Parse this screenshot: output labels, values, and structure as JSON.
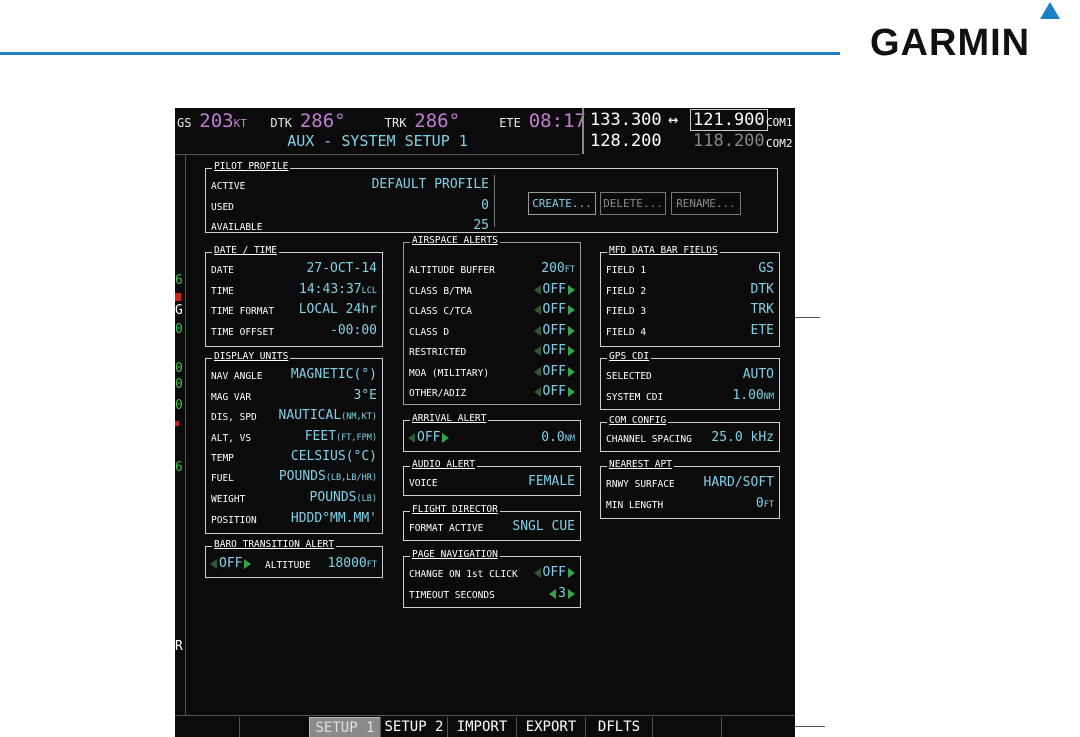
{
  "brand": "GARMIN",
  "topbar": {
    "gs_label": "GS",
    "gs_value": "203",
    "gs_unit": "KT",
    "dtk_label": "DTK",
    "dtk_value": "286°",
    "trk_label": "TRK",
    "trk_value": "286°",
    "ete_label": "ETE",
    "ete_value": "08:17",
    "page_title": "AUX - SYSTEM SETUP 1"
  },
  "com": {
    "com1_active": "133.300",
    "swap": "↔",
    "com1_standby": "121.900",
    "com1_label": "COM1",
    "com2_active": "128.200",
    "com2_standby": "118.200",
    "com2_label": "COM2"
  },
  "left_strip": [
    "6",
    "G",
    "0",
    "0",
    "0",
    "0",
    "6",
    "R"
  ],
  "pilot_profile": {
    "title": "PILOT PROFILE",
    "rows": [
      {
        "k": "ACTIVE",
        "v": "DEFAULT PROFILE"
      },
      {
        "k": "USED",
        "v": "0"
      },
      {
        "k": "AVAILABLE",
        "v": "25"
      }
    ],
    "buttons": [
      "CREATE...",
      "DELETE...",
      "RENAME..."
    ]
  },
  "date_time": {
    "title": "DATE / TIME",
    "rows": [
      {
        "k": "DATE",
        "v": "27-OCT-14"
      },
      {
        "k": "TIME",
        "v": "14:43:37",
        "u": "LCL"
      },
      {
        "k": "TIME FORMAT",
        "v": "LOCAL 24hr"
      },
      {
        "k": "TIME OFFSET",
        "v": "-00:00"
      }
    ]
  },
  "display_units": {
    "title": "DISPLAY UNITS",
    "rows": [
      {
        "k": "NAV ANGLE",
        "v": "MAGNETIC(°)"
      },
      {
        "k": "MAG VAR",
        "v": "3°E"
      },
      {
        "k": "DIS, SPD",
        "v": "NAUTICAL",
        "u": "(NM,KT)"
      },
      {
        "k": "ALT, VS",
        "v": "FEET",
        "u": "(FT,FPM)"
      },
      {
        "k": "TEMP",
        "v": "CELSIUS(°C)"
      },
      {
        "k": "FUEL",
        "v": "POUNDS",
        "u": "(LB,LB/HR)"
      },
      {
        "k": "WEIGHT",
        "v": "POUNDS",
        "u": "(LB)"
      },
      {
        "k": "POSITION",
        "v": "HDDD°MM.MM'"
      }
    ]
  },
  "baro_alert": {
    "title": "BARO TRANSITION ALERT",
    "state": "OFF",
    "alt_label": "ALTITUDE",
    "alt_value": "18000",
    "alt_unit": "FT"
  },
  "airspace_alerts": {
    "title": "AIRSPACE ALERTS",
    "buffer_label": "ALTITUDE BUFFER",
    "buffer_value": "200",
    "buffer_unit": "FT",
    "rows": [
      {
        "k": "CLASS B/TMA",
        "v": "OFF"
      },
      {
        "k": "CLASS C/TCA",
        "v": "OFF"
      },
      {
        "k": "CLASS D",
        "v": "OFF"
      },
      {
        "k": "RESTRICTED",
        "v": "OFF"
      },
      {
        "k": "MOA (MILITARY)",
        "v": "OFF"
      },
      {
        "k": "OTHER/ADIZ",
        "v": "OFF"
      }
    ]
  },
  "arrival_alert": {
    "title": "ARRIVAL ALERT",
    "state": "OFF",
    "value": "0.0",
    "unit": "NM"
  },
  "audio_alert": {
    "title": "AUDIO ALERT",
    "k": "VOICE",
    "v": "FEMALE"
  },
  "flight_director": {
    "title": "FLIGHT DIRECTOR",
    "k": "FORMAT ACTIVE",
    "v": "SNGL CUE"
  },
  "page_navigation": {
    "title": "PAGE NAVIGATION",
    "rows": [
      {
        "k": "CHANGE ON 1st CLICK",
        "v": "OFF"
      },
      {
        "k": "TIMEOUT SECONDS",
        "v": "3"
      }
    ]
  },
  "mfd_fields": {
    "title": "MFD DATA BAR FIELDS",
    "rows": [
      {
        "k": "FIELD 1",
        "v": "GS"
      },
      {
        "k": "FIELD 2",
        "v": "DTK"
      },
      {
        "k": "FIELD 3",
        "v": "TRK"
      },
      {
        "k": "FIELD 4",
        "v": "ETE"
      }
    ]
  },
  "gps_cdi": {
    "title": "GPS CDI",
    "rows": [
      {
        "k": "SELECTED",
        "v": "AUTO"
      },
      {
        "k": "SYSTEM CDI",
        "v": "1.00",
        "u": "NM"
      }
    ]
  },
  "com_config": {
    "title": "COM CONFIG",
    "k": "CHANNEL SPACING",
    "v": "25.0 kHz"
  },
  "nearest_apt": {
    "title": "NEAREST APT",
    "rows": [
      {
        "k": "RNWY SURFACE",
        "v": "HARD/SOFT"
      },
      {
        "k": "MIN LENGTH",
        "v": "0",
        "u": "FT"
      }
    ]
  },
  "softkeys": [
    "SETUP 1",
    "SETUP 2",
    "IMPORT",
    "EXPORT",
    "DFLTS"
  ]
}
